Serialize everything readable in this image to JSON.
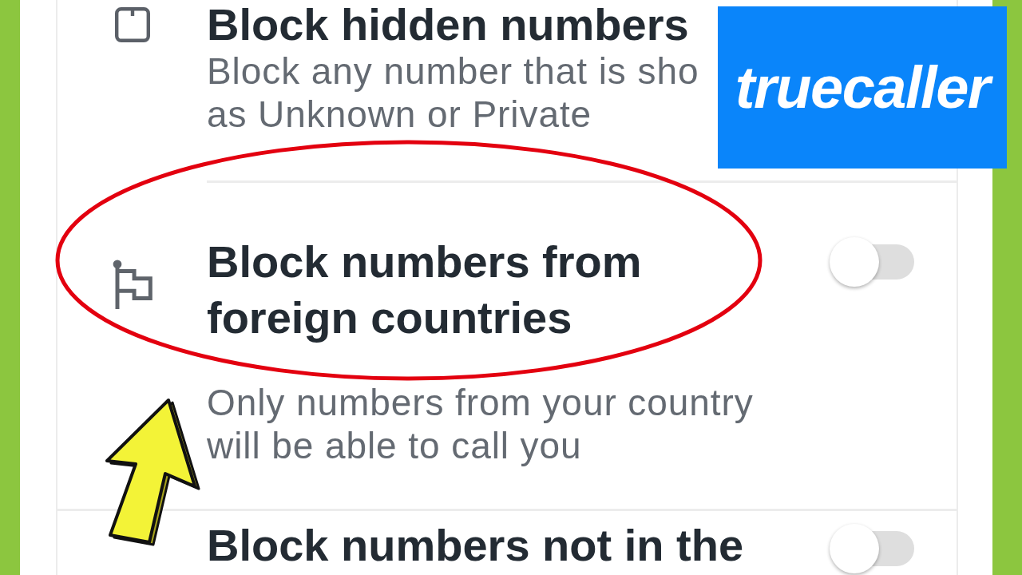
{
  "logo": {
    "text": "truecaller"
  },
  "settings": [
    {
      "title": "Block hidden numbers",
      "description": "Block any number that is sho\nas Unknown or Private"
    },
    {
      "title": "Block numbers from\nforeign countries",
      "description": "Only numbers from your country\nwill be able to call you",
      "toggle": {
        "on": false
      }
    },
    {
      "title": "Block numbers not in the",
      "toggle": {
        "on": false
      }
    }
  ]
}
